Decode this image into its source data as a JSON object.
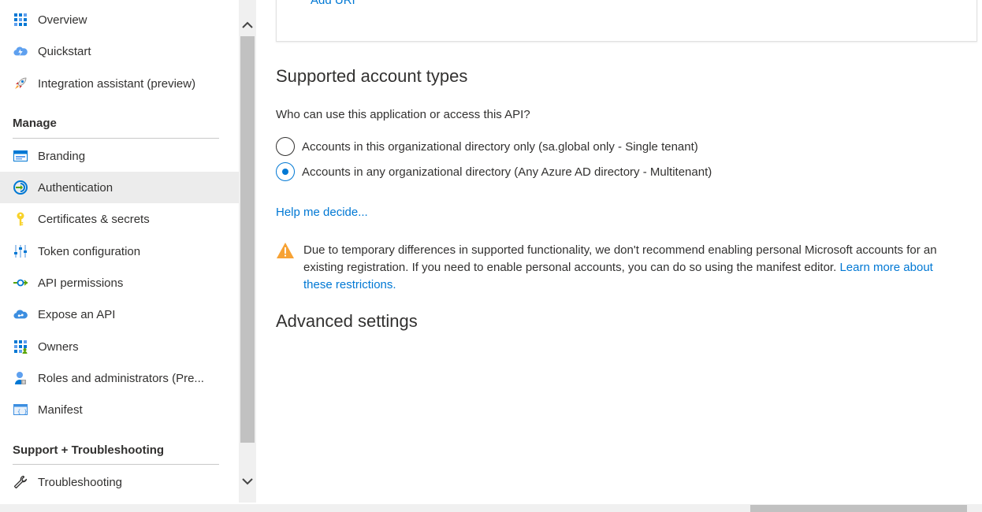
{
  "sidebar": {
    "items_top": [
      {
        "label": "Overview",
        "icon": "grid-icon"
      },
      {
        "label": "Quickstart",
        "icon": "cloud-lightning-icon"
      },
      {
        "label": "Integration assistant (preview)",
        "icon": "rocket-icon"
      }
    ],
    "manage_header": "Manage",
    "manage_items": [
      {
        "label": "Branding",
        "icon": "branding-icon"
      },
      {
        "label": "Authentication",
        "icon": "authentication-icon",
        "selected": true
      },
      {
        "label": "Certificates & secrets",
        "icon": "key-icon"
      },
      {
        "label": "Token configuration",
        "icon": "sliders-icon"
      },
      {
        "label": "API permissions",
        "icon": "api-permissions-icon"
      },
      {
        "label": "Expose an API",
        "icon": "cloud-icon"
      },
      {
        "label": "Owners",
        "icon": "owners-grid-icon"
      },
      {
        "label": "Roles and administrators (Pre...",
        "icon": "user-badge-icon"
      },
      {
        "label": "Manifest",
        "icon": "manifest-icon"
      }
    ],
    "support_header": "Support + Troubleshooting",
    "support_items": [
      {
        "label": "Troubleshooting",
        "icon": "wrench-icon"
      }
    ]
  },
  "main": {
    "add_uri": "Add URI",
    "supported_title": "Supported account types",
    "question": "Who can use this application or access this API?",
    "radio_options": [
      {
        "label": "Accounts in this organizational directory only (sa.global only - Single tenant)",
        "checked": false
      },
      {
        "label": "Accounts in any organizational directory (Any Azure AD directory - Multitenant)",
        "checked": true
      }
    ],
    "help_link": "Help me decide...",
    "warning_text": "Due to temporary differences in supported functionality, we don't recommend enabling personal Microsoft accounts for an existing registration. If you need to enable personal accounts, you can do so using the manifest editor.",
    "warning_link": "Learn more about these restrictions.",
    "advanced_title": "Advanced settings"
  },
  "colors": {
    "accent": "#0078d4",
    "warning": "#f7a234",
    "selected_bg": "#ececec"
  }
}
